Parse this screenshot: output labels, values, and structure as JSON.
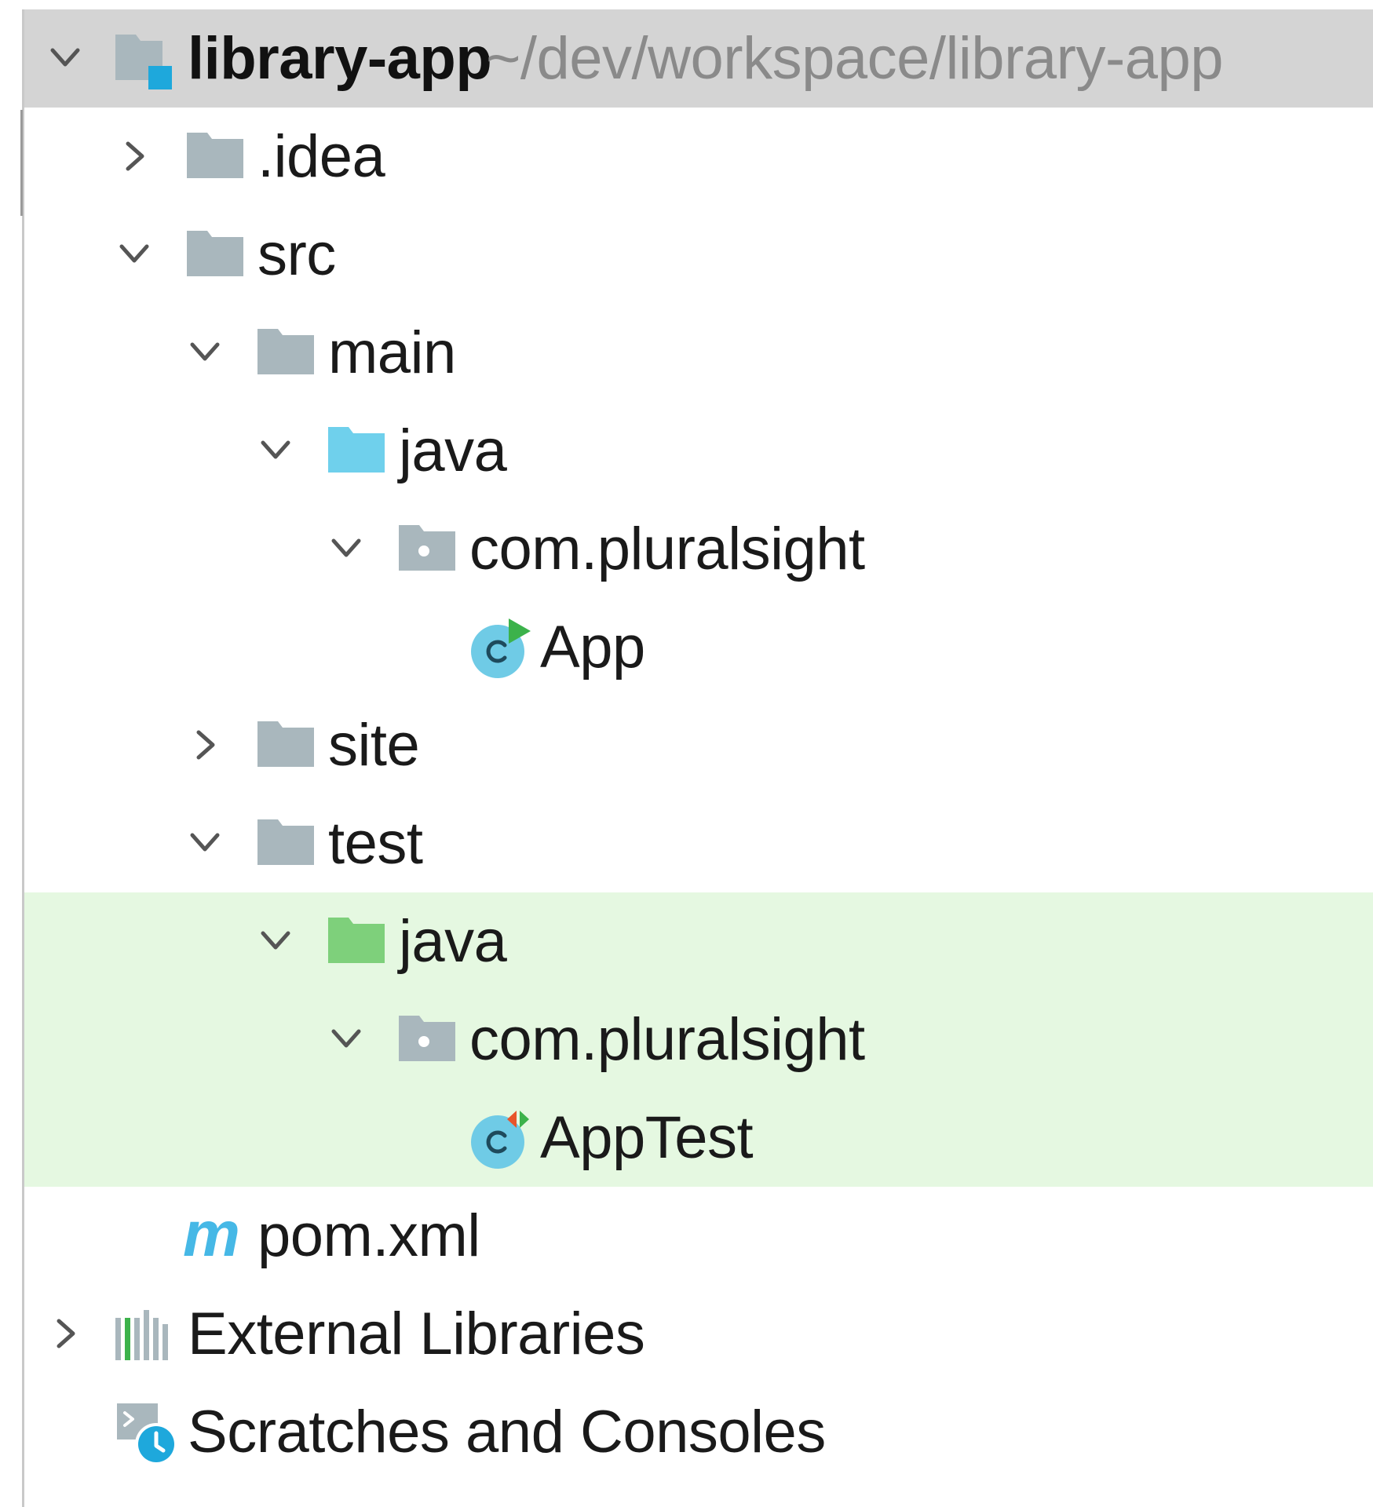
{
  "project_tree": {
    "root": {
      "name": "library-app",
      "path": "~/dev/workspace/library-app",
      "expanded": true
    },
    "items": [
      {
        "label": ".idea",
        "kind": "folder",
        "expanded": false
      },
      {
        "label": "src",
        "kind": "folder",
        "expanded": true
      },
      {
        "label": "main",
        "kind": "folder",
        "expanded": true
      },
      {
        "label": "java",
        "kind": "source-root-folder",
        "expanded": true
      },
      {
        "label": "com.pluralsight",
        "kind": "package",
        "expanded": true
      },
      {
        "label": "App",
        "kind": "runnable-class"
      },
      {
        "label": "site",
        "kind": "folder",
        "expanded": false
      },
      {
        "label": "test",
        "kind": "folder",
        "expanded": true
      },
      {
        "label": "java",
        "kind": "test-root-folder",
        "expanded": true
      },
      {
        "label": "com.pluralsight",
        "kind": "package",
        "expanded": true
      },
      {
        "label": "AppTest",
        "kind": "test-class"
      },
      {
        "label": "pom.xml",
        "kind": "maven-file"
      },
      {
        "label": "External Libraries",
        "kind": "libraries",
        "expanded": false
      },
      {
        "label": "Scratches and Consoles",
        "kind": "scratches"
      }
    ]
  },
  "colors": {
    "selected_row": "#d4d4d4",
    "test_zone": "#e5f8e1",
    "folder_gray": "#a9b7bd",
    "source_folder_blue": "#6fd0ec",
    "test_folder_green": "#7ed07b",
    "class_icon": "#6fcbe6",
    "run_green": "#3cb24b",
    "test_red": "#e8542b",
    "maven_blue": "#46b8e6",
    "path_gray": "#8a8a8a"
  }
}
